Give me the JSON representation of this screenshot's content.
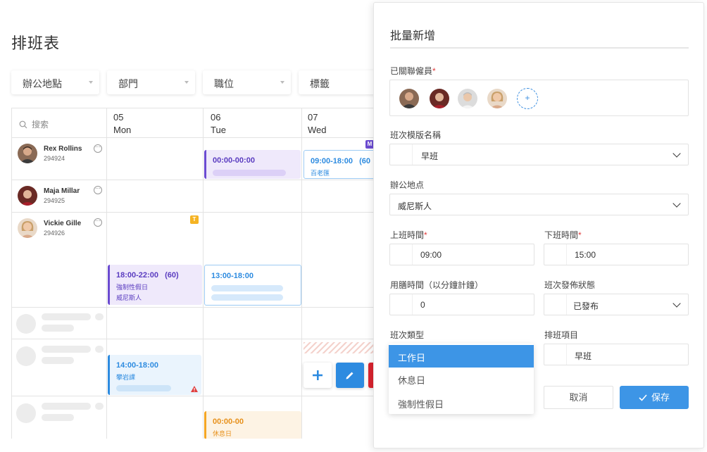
{
  "page": {
    "title": "排班表"
  },
  "filters": [
    {
      "label": "辦公地點"
    },
    {
      "label": "部門"
    },
    {
      "label": "職位"
    },
    {
      "label": "標籤"
    }
  ],
  "grid": {
    "search_placeholder": "搜索",
    "days": [
      {
        "date": "05",
        "weekday": "Mon"
      },
      {
        "date": "06",
        "weekday": "Tue"
      },
      {
        "date": "07",
        "weekday": "Wed"
      }
    ],
    "employees": [
      {
        "name": "Rex Rollins",
        "id": "294924"
      },
      {
        "name": "Maja Millar",
        "id": "294925"
      },
      {
        "name": "Vickie Gille",
        "id": "294926"
      }
    ],
    "shifts": {
      "rex_tue": {
        "time": "00:00-00:00"
      },
      "rex_wed": {
        "time": "09:00-18:00",
        "count": "(60",
        "location": "百老匯"
      },
      "vickie_mon": {
        "time": "18:00-22:00",
        "count": "(60)",
        "type": "強制性假日",
        "location": "威尼斯人"
      },
      "vickie_tue": {
        "time": "13:00-18:00"
      },
      "row5_mon": {
        "time": "14:00-18:00",
        "location": "攀岩課"
      },
      "row6_tue": {
        "time": "00:00-00",
        "type": "休息日"
      }
    },
    "badges": {
      "wed_marker": "M",
      "vickie_mon": "T"
    }
  },
  "panel": {
    "title": "批量新增",
    "assignees_label": "已關聯僱員",
    "assignees_add": "+",
    "template_label": "班次模版名稱",
    "template_value": "早班",
    "location_label": "辦公地点",
    "location_value": "威尼斯人",
    "start_label": "上班時間",
    "start_value": "09:00",
    "end_label": "下班時間",
    "end_value": "15:00",
    "meal_label": "用膳時間（以分鐘計鐘）",
    "meal_value": "0",
    "publish_label": "班次發佈狀態",
    "publish_value": "已發布",
    "shift_type_label": "班次類型",
    "shift_type_options": [
      "工作日",
      "休息日",
      "強制性假日"
    ],
    "item_label": "排班項目",
    "item_value": "早班",
    "cancel": "取消",
    "save": "保存"
  },
  "colors": {
    "accent": "#3d95e6",
    "purple": "#6b4bd1",
    "blue_shift": "#2d8be0",
    "orange": "#f5a623",
    "red": "#e03c3c"
  }
}
